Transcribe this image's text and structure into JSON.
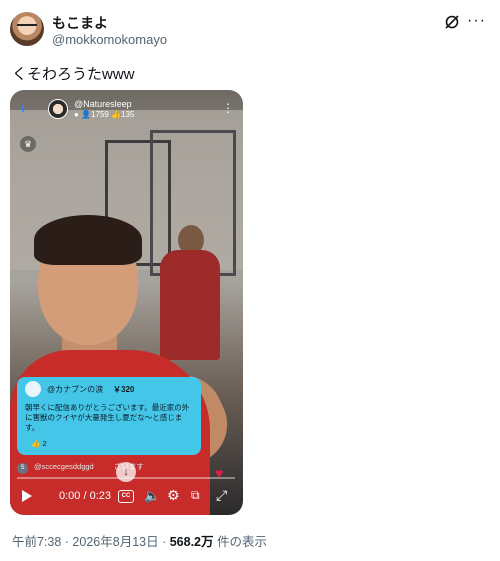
{
  "author": {
    "display_name": "もこまよ",
    "handle": "@mokkomokomayo"
  },
  "header": {
    "more_icon": "more-horizontal-icon",
    "grok_icon": "grok-icon"
  },
  "tweet": {
    "text": "くそわろうたwww"
  },
  "video": {
    "stream_name": "@Naturesleep",
    "viewers": "1759",
    "likes": "135",
    "donation": {
      "user": "@カナブンの涙",
      "amount": "￥320",
      "message": "朝早くに配信ありがとうございます。最近家の外に害獣のクイヤが大量発生し夏だな〜と感じます。",
      "like_count": "2"
    },
    "comment": {
      "badge": "S",
      "user": "@sccecgesddggd",
      "text": "ざいます"
    },
    "time_display": "0:00 / 0:23",
    "progress": 0.0
  },
  "footer": {
    "timestamp": "午前7:38 · 2026年8月13日 · ",
    "views": "568.2万",
    "views_suffix": " 件の表示"
  }
}
